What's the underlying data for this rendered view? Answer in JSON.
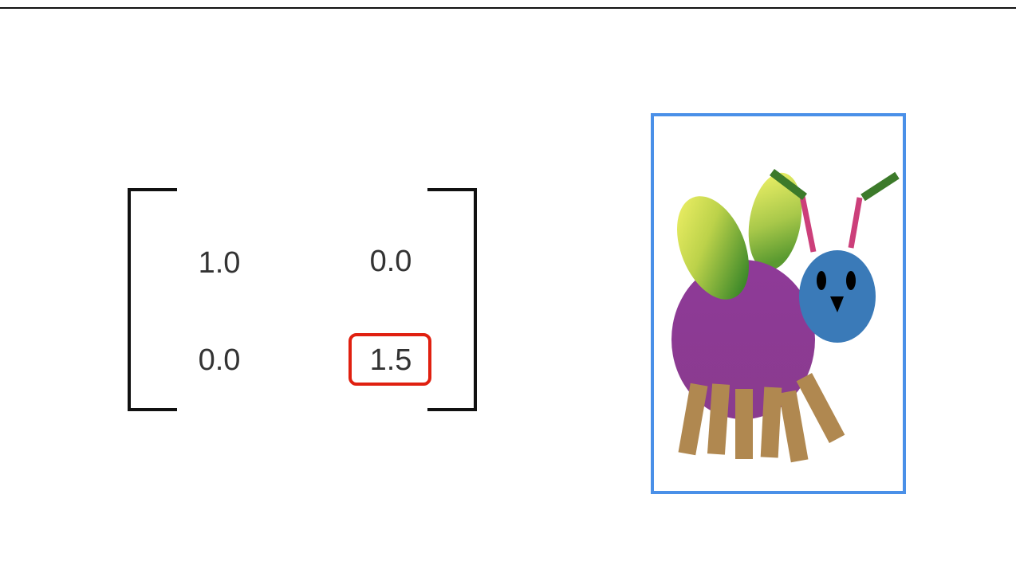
{
  "matrix": {
    "rows": [
      [
        "1.0",
        "0.0"
      ],
      [
        "0.0",
        "1.5"
      ]
    ],
    "highlighted_cell": "1.5",
    "highlight_color": "#e02010"
  },
  "image_frame": {
    "border_color": "#4a90e8",
    "subject": "bug-illustration",
    "colors": {
      "body": "#8a3b94",
      "head": "#3a7ab8",
      "wings": [
        "#f5f56a",
        "#3f8a2a"
      ],
      "legs": "#b08850",
      "antennae": "#cc3f7a",
      "antenna_tips": "#3c7a2a"
    }
  }
}
